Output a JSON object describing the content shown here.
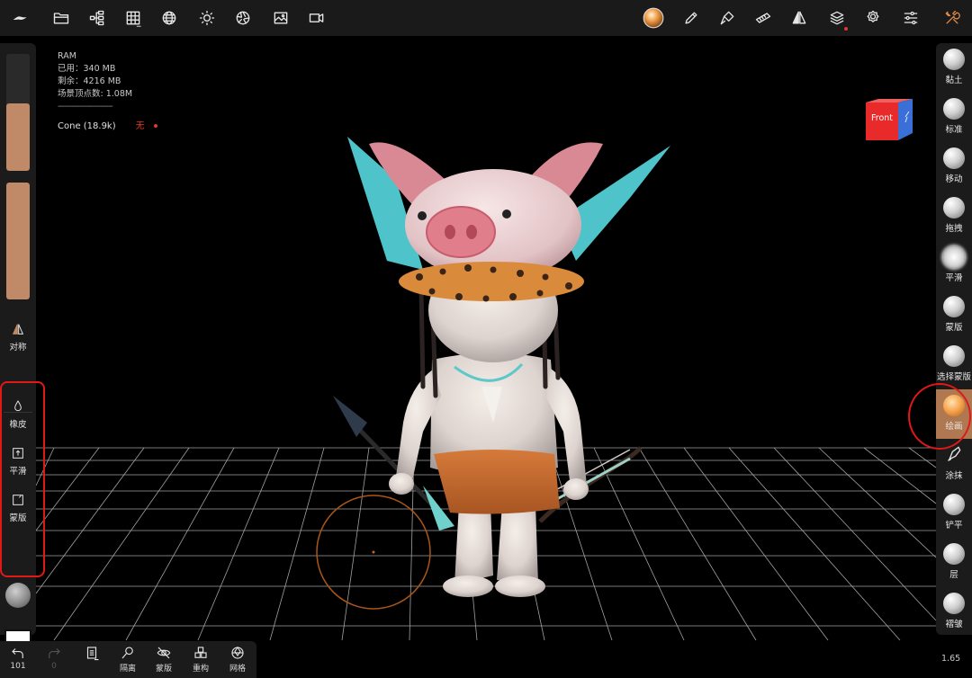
{
  "top_toolbar": {
    "left_icons": [
      "app-logo-icon",
      "folder-icon",
      "scene-tree-icon",
      "grid-icon",
      "sphere-mesh-icon",
      "sun-icon",
      "camera-shutter-icon",
      "image-icon",
      "video-icon"
    ],
    "right_icons": [
      "material-sphere-icon",
      "pencil-icon",
      "brush-icon",
      "ruler-icon",
      "symmetry-icon",
      "layers-icon",
      "gear-icon",
      "sliders-icon",
      "tools-icon"
    ]
  },
  "info": {
    "ram_title": "RAM",
    "used": "已用：340 MB",
    "free": "剩余：4216 MB",
    "vertices": "场景顶点数: 1.08M",
    "separator": "-------------------------",
    "object_name": "Cone (18.9k)",
    "object_status": "无"
  },
  "left_panel": {
    "radius_slider": 0.58,
    "intensity_slider": 1.0,
    "symmetry_label": "对称",
    "eraser_label": "橡皮",
    "smooth_label": "平滑",
    "mask_label": "蒙版"
  },
  "right_panel": {
    "tools": [
      "黏土",
      "标准",
      "移动",
      "拖拽",
      "平滑",
      "蒙版",
      "选择蒙版",
      "绘画",
      "涂抹",
      "铲平",
      "层",
      "褶皱"
    ],
    "active_tool": "绘画"
  },
  "nav_cube": {
    "label": "Front"
  },
  "bottom_bar": {
    "undo_count": "101",
    "redo_count": "0",
    "isolate_label": "隔离",
    "mask_label": "蒙版",
    "remesh_label": "重构",
    "mesh_label": "网格"
  },
  "version": "1.65",
  "colors": {
    "accent": "#b07850",
    "slider_fill": "#c08a68",
    "highlight": "#e01818"
  }
}
